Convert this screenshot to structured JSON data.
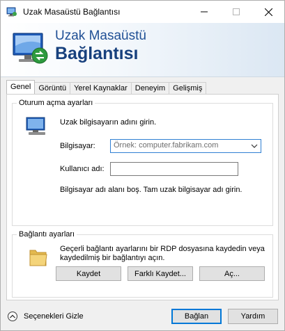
{
  "window": {
    "title": "Uzak Masaüstü Bağlantısı",
    "icon": "remote-desktop-icon"
  },
  "banner": {
    "line1": "Uzak Masaüstü",
    "line2": "Bağlantısı"
  },
  "tabs": [
    {
      "label": "Genel",
      "active": true
    },
    {
      "label": "Görüntü",
      "active": false
    },
    {
      "label": "Yerel Kaynaklar",
      "active": false
    },
    {
      "label": "Deneyim",
      "active": false
    },
    {
      "label": "Gelişmiş",
      "active": false
    }
  ],
  "logon": {
    "legend": "Oturum açma ayarları",
    "instruction": "Uzak bilgisayarın adını girin.",
    "computer_label": "Bilgisayar:",
    "computer_placeholder": "Örnek: computer.fabrikam.com",
    "username_label": "Kullanıcı adı:",
    "username_value": "",
    "note": "Bilgisayar adı alanı boş. Tam uzak bilgisayar adı girin."
  },
  "connection": {
    "legend": "Bağlantı ayarları",
    "description_line1": "Geçerli bağlantı ayarlarını bir RDP dosyasına kaydedin veya",
    "description_line2": "kaydedilmiş bir bağlantıyı açın.",
    "save_label": "Kaydet",
    "save_as_label": "Farklı Kaydet...",
    "open_label": "Aç..."
  },
  "footer": {
    "hide_options_label": "Seçenekleri Gizle",
    "connect_label": "Bağlan",
    "help_label": "Yardım"
  },
  "colors": {
    "accent": "#0078d7",
    "banner_text": "#17407d"
  }
}
